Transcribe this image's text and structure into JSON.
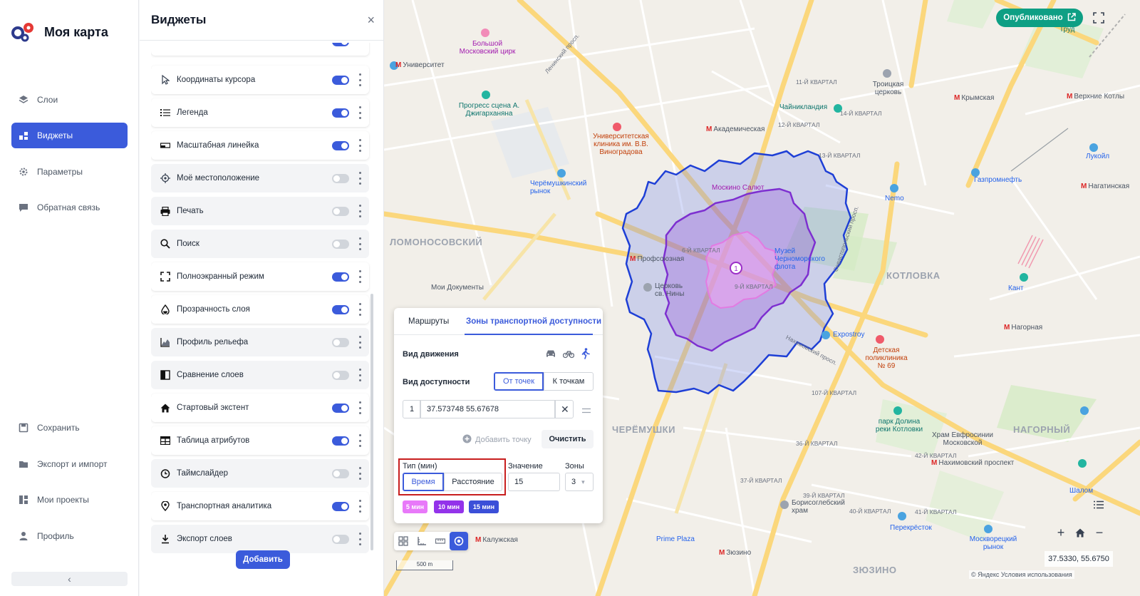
{
  "app": {
    "title": "Моя карта"
  },
  "nav": {
    "items": [
      {
        "label": "Слои",
        "icon": "layers-icon"
      },
      {
        "label": "Виджеты",
        "icon": "widgets-icon",
        "active": true
      },
      {
        "label": "Параметры",
        "icon": "settings-icon"
      },
      {
        "label": "Обратная связь",
        "icon": "feedback-icon"
      }
    ],
    "bottom": [
      {
        "label": "Сохранить",
        "icon": "save-icon"
      },
      {
        "label": "Экспорт и импорт",
        "icon": "export-icon"
      },
      {
        "label": "Мои проекты",
        "icon": "projects-icon"
      },
      {
        "label": "Профиль",
        "icon": "profile-icon"
      }
    ],
    "collapse": "‹"
  },
  "panel": {
    "title": "Виджеты",
    "close": "×",
    "add_button": "Добавить",
    "widgets": [
      {
        "label": "Координаты курсора",
        "on": true
      },
      {
        "label": "Легенда",
        "on": true
      },
      {
        "label": "Масштабная линейка",
        "on": true
      },
      {
        "label": "Моё местоположение",
        "on": false
      },
      {
        "label": "Печать",
        "on": false
      },
      {
        "label": "Поиск",
        "on": false
      },
      {
        "label": "Полноэкранный режим",
        "on": true
      },
      {
        "label": "Прозрачность слоя",
        "on": true
      },
      {
        "label": "Профиль рельефа",
        "on": false
      },
      {
        "label": "Сравнение слоев",
        "on": false
      },
      {
        "label": "Стартовый экстент",
        "on": true
      },
      {
        "label": "Таблица атрибутов",
        "on": true
      },
      {
        "label": "Таймслайдер",
        "on": false
      },
      {
        "label": "Транспортная аналитика",
        "on": true
      },
      {
        "label": "Экспорт слоев",
        "on": false
      }
    ]
  },
  "map": {
    "publish": "Опубликовано",
    "labels": {
      "lomonosovsky": "ЛОМОНОСОВСКИЙ",
      "cheryomushki": "ЧЕРЁМУШКИ",
      "kotlovka": "КОТЛОВКА",
      "nagorny": "НАГОРНЫЙ",
      "zyuzino": "ЗЮЗИНО",
      "universitet": "Университет",
      "akademicheskaya": "Академическая",
      "profsoyuznaya": "Профсоюзная",
      "kaluzhskaya": "Калужская",
      "zyuzino_metro": "Зюзино",
      "nagornaya": "Нагорная",
      "nakhimovsky": "Нахимовский проспект",
      "krymskaya": "Крымская",
      "verkhnie_kotly": "Верхние Котлы",
      "nagatinskaya": "Нагатинская",
      "moskino": "Москино Салют",
      "muzei": "Музей Черноморского флота",
      "tserkov": "Церковь св. Нины",
      "cheryomushkinsky": "Черёмушкинский рынок",
      "klinika": "Университетская клиника им. В.В. Виноградова",
      "tsirk": "Большой Московский цирк",
      "progress": "Прогресс сцена А. Джигарханяна",
      "troitskaya": "Троицкая церковь",
      "chainiklandia": "Чайникландия",
      "gazpromneft": "Газпромнефть",
      "nemo": "Nemo",
      "kant": "Кант",
      "expostroy": "Expostroy",
      "detskaya": "Детская поликлиника № 69",
      "park": "парк Долина реки Котловки",
      "khram": "Храм Евфросинии Московской",
      "borisoglebsky": "Борисоглебский храм",
      "perekrestok": "Перекрёсток",
      "mosvoretsky": "Москворецкий рынок",
      "prime_plaza": "Prime Plaza",
      "moi_dokumenty": "Мои Документы",
      "shalom": "Шалом",
      "lukoil": "Лукойл",
      "trud": "Труд",
      "leninsky": "Ленинский просп.",
      "sevastopolsky": "Севастопольский просп.",
      "nakhimovsky_prosp": "Нахимовский просп.",
      "kv11": "11-Й КВАРТАЛ",
      "kv12": "12-Й КВАРТАЛ",
      "kv13": "13-Й КВАРТАЛ",
      "kv14": "14-Й КВАРТАЛ",
      "kv6": "6-Й КВАРТАЛ",
      "kv9": "9-Й КВАРТАЛ",
      "kv107": "107-Й КВАРТАЛ",
      "kv36": "36-Й КВАРТАЛ",
      "kv37": "37-Й КВАРТАЛ",
      "kv40": "40-Й КВАРТАЛ",
      "kv41": "41-Й КВАРТАЛ",
      "kv39": "39-Й КВАРТАЛ",
      "kv42": "42-Й КВАРТАЛ"
    },
    "coords": "37.5330, 55.6750",
    "scale": "500 m",
    "attribution": "© Яндекс Условия использования",
    "zone_label": "1"
  },
  "transport": {
    "tabs": [
      "Маршруты",
      "Зоны транспортной доступности"
    ],
    "movement_label": "Вид движения",
    "access_label": "Вид доступности",
    "access_options": [
      "От точек",
      "К точкам"
    ],
    "point_index": "1",
    "point_value": "37.573748 55.67678",
    "add_point": "Добавить точку",
    "clear": "Очистить",
    "type_label": "Тип (мин)",
    "type_options": [
      "Время",
      "Расстояние"
    ],
    "value_label": "Значение",
    "value": "15",
    "zones_label": "Зоны",
    "zones_value": "3",
    "chips": [
      {
        "label": "5 мин",
        "color": "#e879f9"
      },
      {
        "label": "10 мин",
        "color": "#9333ea"
      },
      {
        "label": "15 мин",
        "color": "#3b4fd8"
      }
    ]
  }
}
